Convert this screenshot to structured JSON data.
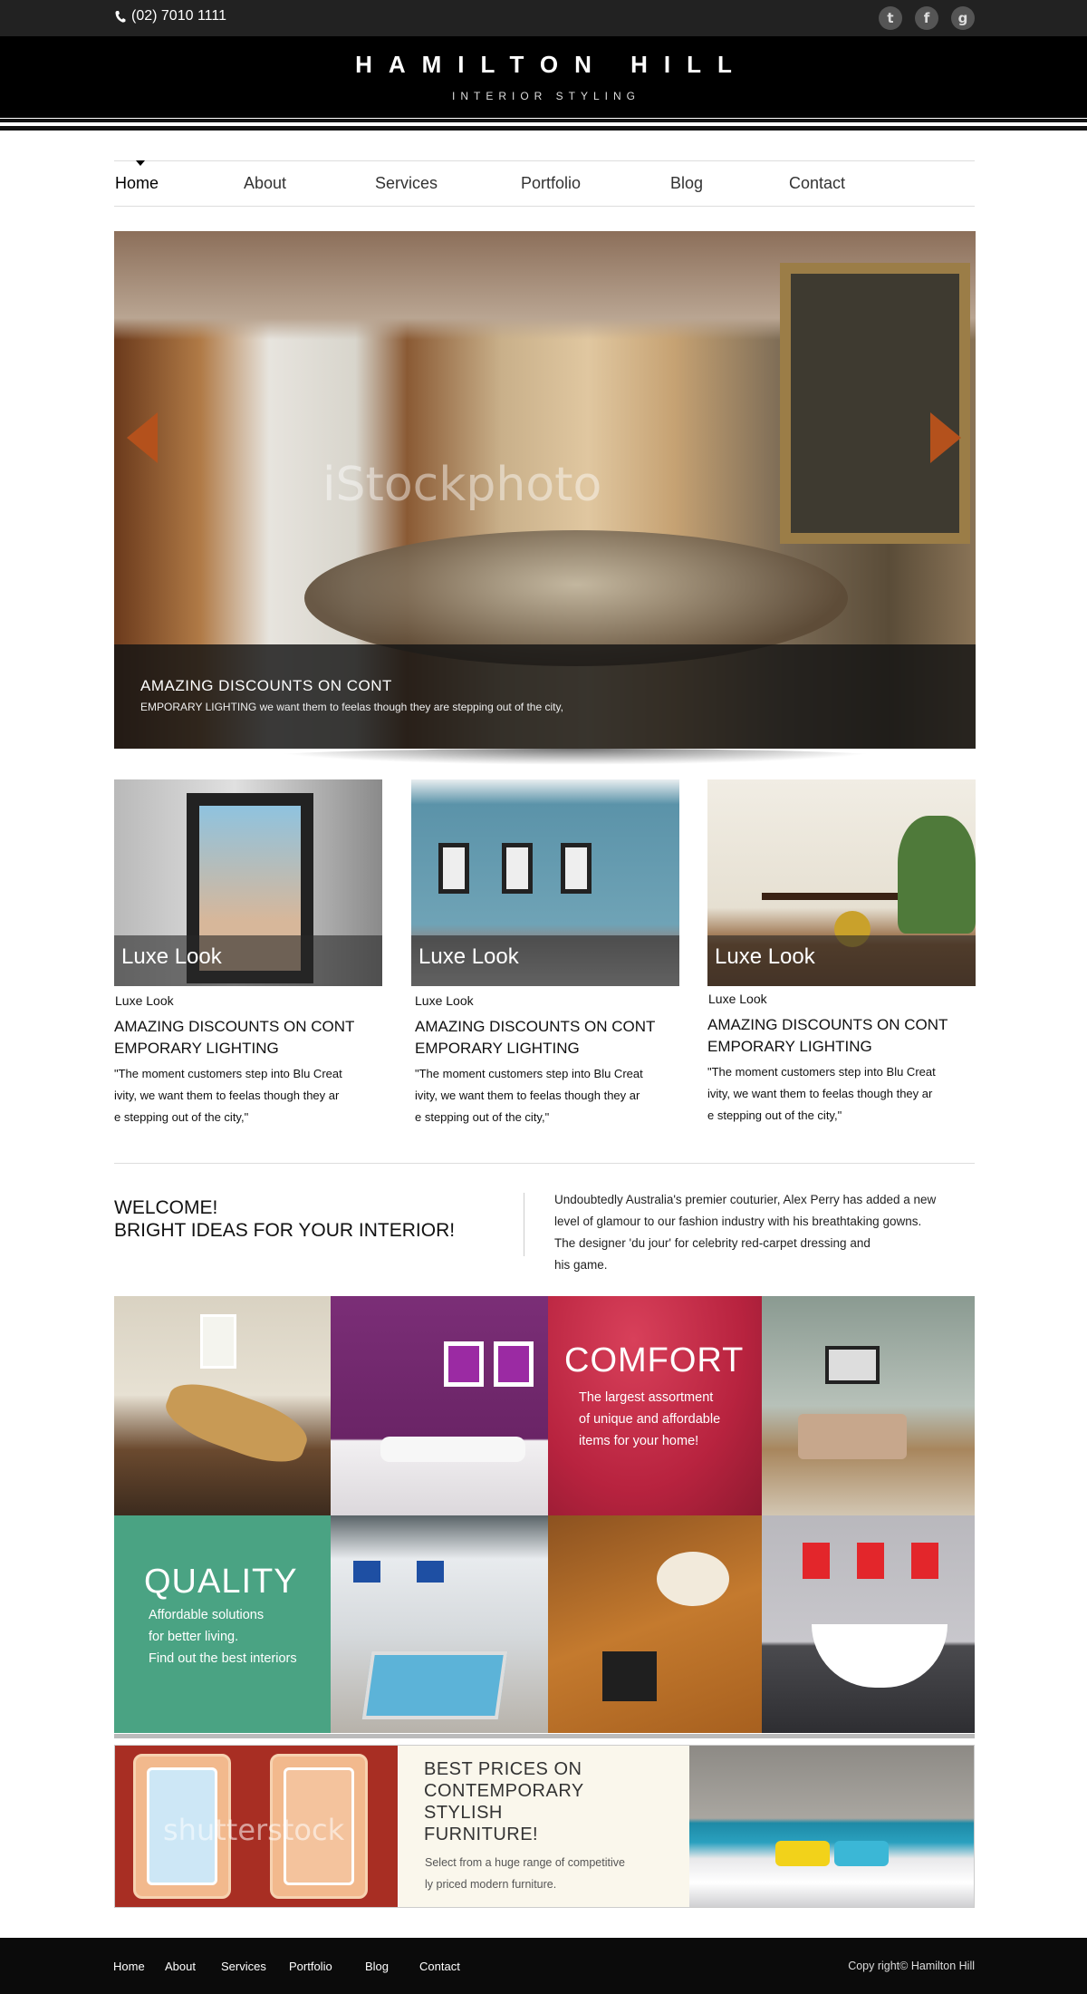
{
  "topbar": {
    "phone": "(02) 7010 1111",
    "social": [
      "t",
      "f",
      "g"
    ]
  },
  "header": {
    "title": "HAMILTON HILL",
    "subtitle": "INTERIOR STYLING"
  },
  "nav": {
    "items": [
      "Home",
      "About",
      "Services",
      "Portfolio",
      "Blog",
      "Contact"
    ],
    "active": "Home"
  },
  "hero": {
    "caption_title": "AMAZING DISCOUNTS ON CONT",
    "caption_text": "EMPORARY LIGHTING  we want them to feelas though they are stepping out of the city,",
    "watermark": "iStockphoto"
  },
  "cards": [
    {
      "overlay": "Luxe Look",
      "label": "Luxe Look",
      "title_line1": "AMAZING DISCOUNTS ON CONT",
      "title_line2": "EMPORARY LIGHTING",
      "text_line1": "\"The moment customers step into Blu Creat",
      "text_line2": "ivity, we want them to feelas though they ar",
      "text_line3": "e stepping out of the city,\""
    },
    {
      "overlay": "Luxe Look",
      "label": "Luxe Look",
      "title_line1": "AMAZING DISCOUNTS ON CONT",
      "title_line2": "EMPORARY LIGHTING",
      "text_line1": "\"The moment customers step into Blu Creat",
      "text_line2": "ivity, we want them to feelas though they ar",
      "text_line3": "e stepping out of the city,\""
    },
    {
      "overlay": "Luxe Look",
      "label": "Luxe Look",
      "title_line1": "AMAZING DISCOUNTS ON CONT",
      "title_line2": "EMPORARY LIGHTING",
      "text_line1": "\"The moment customers step into Blu Creat",
      "text_line2": "ivity, we want them to feelas though they ar",
      "text_line3": "e stepping out of the city,\""
    }
  ],
  "welcome": {
    "line1": "WELCOME!",
    "line2": "BRIGHT IDEAS FOR YOUR INTERIOR!",
    "text_line1": "Undoubtedly Australia's premier couturier, Alex Perry has added a new",
    "text_line2": "level of glamour to our fashion industry with his breathtaking gowns.",
    "text_line3": "The designer 'du jour' for celebrity red-carpet dressing and",
    "text_line4": "his game."
  },
  "comfort": {
    "title": "COMFORT",
    "line1": "The largest assortment",
    "line2": "of unique and affordable",
    "line3": "items for your home!"
  },
  "quality": {
    "title": "QUALITY",
    "line1": "Affordable solutions",
    "line2": "for better living.",
    "line3": "Find out the best interiors"
  },
  "promo": {
    "title_line1": "BEST PRICES ON",
    "title_line2": "CONTEMPORARY",
    "title_line3": "STYLISH",
    "title_line4": "FURNITURE!",
    "text_line1": "Select from a huge range of competitive",
    "text_line2": "ly priced modern furniture.",
    "watermark": "shutterstock"
  },
  "footer": {
    "links": [
      "Home",
      "About",
      "Services",
      "Portfolio",
      "Blog",
      "Contact"
    ],
    "copyright": "Copy right© Hamilton Hill"
  },
  "colors": {
    "accent_orange": "#b4511c",
    "comfort_red": "#b8233f",
    "quality_green": "#4aa383",
    "header_black": "#000000"
  }
}
